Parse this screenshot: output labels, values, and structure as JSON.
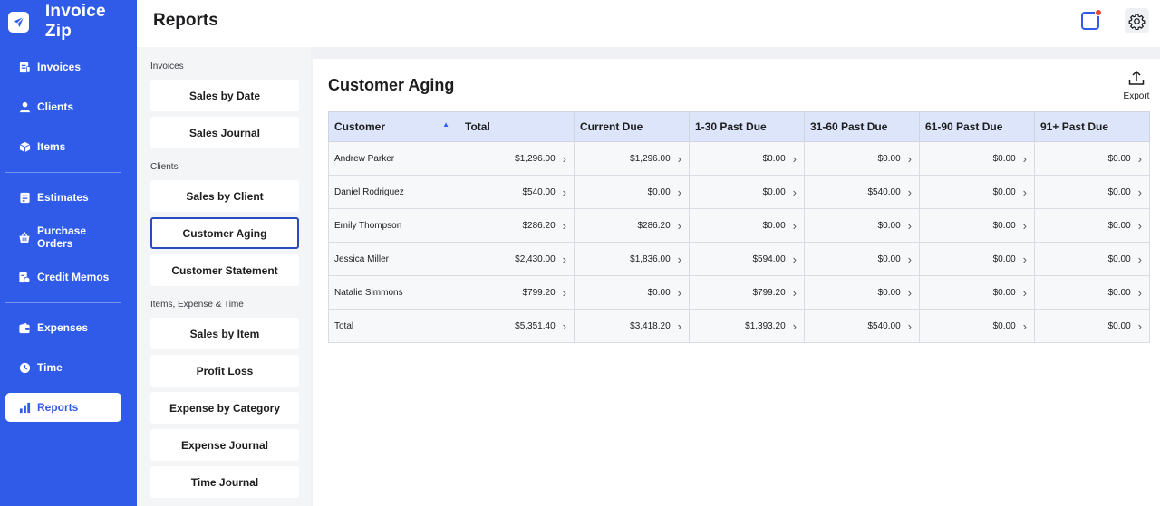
{
  "app": {
    "name": "Invoice Zip"
  },
  "sidebar": {
    "items": [
      {
        "label": "Invoices",
        "icon": "invoice-icon"
      },
      {
        "label": "Clients",
        "icon": "user-icon"
      },
      {
        "label": "Items",
        "icon": "box-icon"
      },
      {
        "label": "Estimates",
        "icon": "estimate-icon"
      },
      {
        "label": "Purchase Orders",
        "icon": "basket-icon"
      },
      {
        "label": "Credit Memos",
        "icon": "credit-memo-icon"
      },
      {
        "label": "Expenses",
        "icon": "wallet-icon"
      },
      {
        "label": "Time",
        "icon": "clock-icon"
      },
      {
        "label": "Reports",
        "icon": "bar-chart-icon"
      }
    ],
    "active": "Reports"
  },
  "header": {
    "title": "Reports"
  },
  "reports": {
    "groups": [
      {
        "label": "Invoices",
        "items": [
          "Sales by Date",
          "Sales Journal"
        ]
      },
      {
        "label": "Clients",
        "items": [
          "Sales by Client",
          "Customer Aging",
          "Customer Statement"
        ]
      },
      {
        "label": "Items, Expense & Time",
        "items": [
          "Sales by Item",
          "Profit Loss",
          "Expense by Category",
          "Expense Journal",
          "Time Journal"
        ]
      }
    ],
    "selected": "Customer Aging"
  },
  "main": {
    "title": "Customer Aging",
    "export_label": "Export"
  },
  "table": {
    "columns": [
      "Customer",
      "Total",
      "Current Due",
      "1-30 Past Due",
      "31-60 Past Due",
      "61-90 Past Due",
      "91+ Past Due"
    ],
    "rows": [
      [
        "Andrew Parker",
        "$1,296.00",
        "$1,296.00",
        "$0.00",
        "$0.00",
        "$0.00",
        "$0.00"
      ],
      [
        "Daniel Rodriguez",
        "$540.00",
        "$0.00",
        "$0.00",
        "$540.00",
        "$0.00",
        "$0.00"
      ],
      [
        "Emily Thompson",
        "$286.20",
        "$286.20",
        "$0.00",
        "$0.00",
        "$0.00",
        "$0.00"
      ],
      [
        "Jessica Miller",
        "$2,430.00",
        "$1,836.00",
        "$594.00",
        "$0.00",
        "$0.00",
        "$0.00"
      ],
      [
        "Natalie Simmons",
        "$799.20",
        "$0.00",
        "$799.20",
        "$0.00",
        "$0.00",
        "$0.00"
      ],
      [
        "Total",
        "$5,351.40",
        "$3,418.20",
        "$1,393.20",
        "$540.00",
        "$0.00",
        "$0.00"
      ]
    ]
  },
  "colors": {
    "brand": "#2f5be8",
    "notification": "#e8452c",
    "table_header": "#dde5fa"
  }
}
